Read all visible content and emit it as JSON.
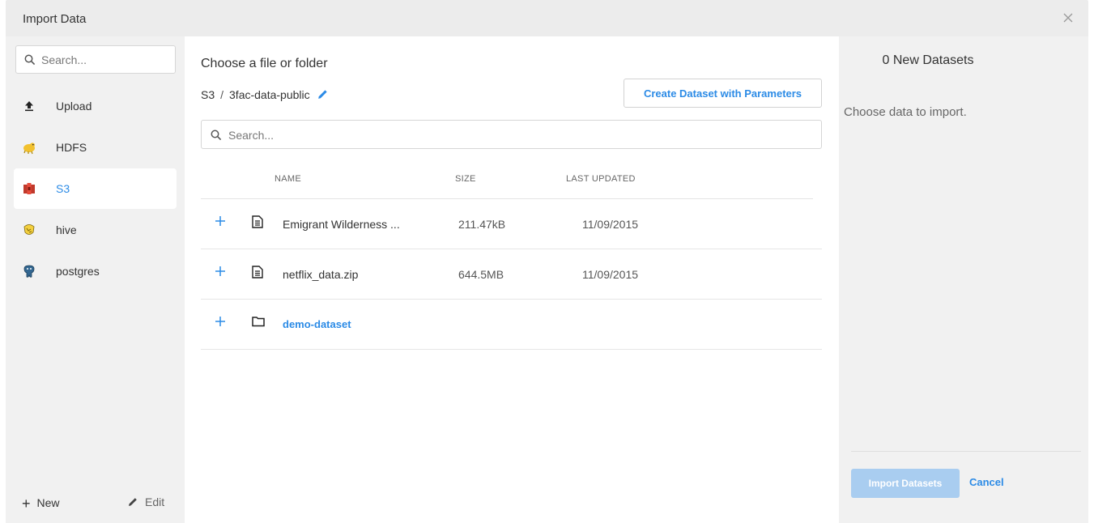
{
  "dialog": {
    "title": "Import Data"
  },
  "sidebar": {
    "search_placeholder": "Search...",
    "items": [
      {
        "label": "Upload",
        "icon": "upload-icon"
      },
      {
        "label": "HDFS",
        "icon": "hdfs-icon"
      },
      {
        "label": "S3",
        "icon": "s3-icon",
        "active": true
      },
      {
        "label": "hive",
        "icon": "hive-icon"
      },
      {
        "label": "postgres",
        "icon": "postgres-icon"
      }
    ],
    "new_label": "New",
    "edit_label": "Edit"
  },
  "main": {
    "heading": "Choose a file or folder",
    "breadcrumb": {
      "root": "S3",
      "separator": "/",
      "bucket": "3fac-data-public"
    },
    "create_button": "Create Dataset with Parameters",
    "search_placeholder": "Search...",
    "columns": {
      "name": "NAME",
      "size": "SIZE",
      "updated": "LAST UPDATED"
    },
    "rows": [
      {
        "type": "file",
        "name": "Emigrant Wilderness ...",
        "size": "211.47kB",
        "updated": "11/09/2015"
      },
      {
        "type": "file",
        "name": "netflix_data.zip",
        "size": "644.5MB",
        "updated": "11/09/2015"
      },
      {
        "type": "folder",
        "name": "demo-dataset",
        "size": "",
        "updated": ""
      }
    ]
  },
  "right": {
    "count_title": "0 New Datasets",
    "hint": "Choose data to import.",
    "import_button": "Import Datasets",
    "cancel_button": "Cancel"
  },
  "colors": {
    "accent": "#2c8be6",
    "disabled_button": "#a9cdf0",
    "panel_bg": "#f1f1f1",
    "titlebar_bg": "#ececec"
  }
}
